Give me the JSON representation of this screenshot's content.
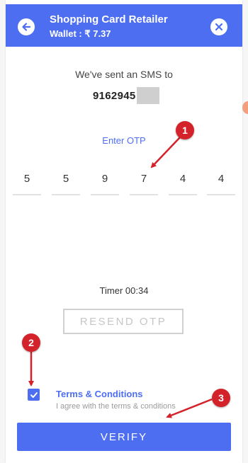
{
  "header": {
    "title": "Shopping Card Retailer",
    "wallet": "Wallet : ₹ 7.37"
  },
  "otp_screen": {
    "sms_text": "We've sent an SMS to",
    "phone_number": "9162945",
    "enter_otp_label": "Enter OTP",
    "otp_digits": [
      "5",
      "5",
      "9",
      "7",
      "4",
      "4"
    ],
    "timer": "Timer 00:34",
    "resend_label": "RESEND OTP"
  },
  "terms": {
    "checked": true,
    "title": "Terms & Conditions",
    "subtitle": "I agree with the terms & conditions"
  },
  "verify_label": "VERIFY",
  "annotations": {
    "callout_1": "1",
    "callout_2": "2",
    "callout_3": "3"
  },
  "colors": {
    "accent": "#4e6ef2",
    "callout": "#d3222a"
  }
}
